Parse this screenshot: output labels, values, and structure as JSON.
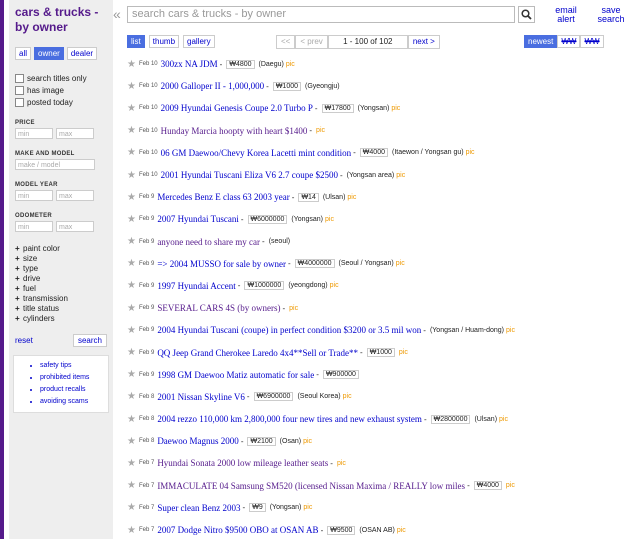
{
  "header": {
    "category_title": "cars & trucks - by owner",
    "search_placeholder": "search cars & trucks - by owner",
    "email_alert": "email alert",
    "save_search": "save search"
  },
  "sidebar": {
    "owner_tabs": [
      "all",
      "owner",
      "dealer"
    ],
    "selected_owner_tab": "owner",
    "checkboxes": [
      "search titles only",
      "has image",
      "posted today"
    ],
    "price_label": "PRICE",
    "min_placeholder": "min",
    "max_placeholder": "max",
    "make_model_label": "MAKE AND MODEL",
    "make_model_placeholder": "make / model",
    "model_year_label": "MODEL YEAR",
    "odometer_label": "ODOMETER",
    "expand_filters": [
      "paint color",
      "size",
      "type",
      "drive",
      "fuel",
      "transmission",
      "title status",
      "cylinders"
    ],
    "reset": "reset",
    "search": "search",
    "safety_links": [
      "safety tips",
      "prohibited items",
      "product recalls",
      "avoiding scams"
    ]
  },
  "view_tabs": [
    "list",
    "thumb",
    "gallery"
  ],
  "selected_view": "list",
  "pager": {
    "first": "<<",
    "prev": "< prev",
    "range": "1 - 100 of 102",
    "next": "next >"
  },
  "sort_tabs": [
    "newest",
    "₩₩",
    "₩₩"
  ],
  "listings": [
    {
      "date": "Feb 10",
      "title": "300zx NA JDM",
      "price": "₩4800",
      "location": "(Daegu)",
      "pic": "pic",
      "visited": false
    },
    {
      "date": "Feb 10",
      "title": "2000 Galloper II - 1,000,000",
      "price": "₩1000",
      "location": "(Gyeongju)",
      "pic": "",
      "visited": false
    },
    {
      "date": "Feb 10",
      "title": "2009 Hyundai Genesis Coupe 2.0 Turbo P",
      "price": "₩17800",
      "location": "(Yongsan)",
      "pic": "pic",
      "visited": false
    },
    {
      "date": "Feb 10",
      "title": "Hunday Marcia hoopty with heart $1400",
      "price": "",
      "location": "",
      "pic": "pic",
      "visited": true
    },
    {
      "date": "Feb 10",
      "title": "06 GM Daewoo/Chevy Korea Lacetti mint condition",
      "price": "₩4000",
      "location": "(Itaewon / Yongsan gu)",
      "pic": "pic",
      "visited": false
    },
    {
      "date": "Feb 10",
      "title": "2001 Hyundai Tuscani Eliza V6 2.7 coupe $2500",
      "price": "",
      "location": "(Yongsan area)",
      "pic": "pic",
      "visited": false
    },
    {
      "date": "Feb 9",
      "title": "Mercedes Benz E class 63 2003 year",
      "price": "₩14",
      "location": "(Ulsan)",
      "pic": "pic",
      "visited": false
    },
    {
      "date": "Feb 9",
      "title": "2007 Hyundai Tuscani",
      "price": "₩6000000",
      "location": "(Yongsan)",
      "pic": "pic",
      "visited": false
    },
    {
      "date": "Feb 9",
      "title": "anyone need to share my car",
      "price": "",
      "location": "(seoul)",
      "pic": "",
      "visited": true
    },
    {
      "date": "Feb 9",
      "title": "=> 2004 MUSSO for sale by owner",
      "price": "₩4000000",
      "location": "(Seoul / Yongsan)",
      "pic": "pic",
      "visited": false
    },
    {
      "date": "Feb 9",
      "title": "1997 Hyundai Accent",
      "price": "₩1000000",
      "location": "(yeongdong)",
      "pic": "pic",
      "visited": false
    },
    {
      "date": "Feb 9",
      "title": "SEVERAL CARS 4S (by owners)",
      "price": "",
      "location": "",
      "pic": "pic",
      "visited": true
    },
    {
      "date": "Feb 9",
      "title": "2004 Hyundai Tuscani (coupe) in perfect condition $3200 or 3.5 mil won",
      "price": "",
      "location": "(Yongsan / Huam-dong)",
      "pic": "pic",
      "visited": false
    },
    {
      "date": "Feb 9",
      "title": "QQ Jeep Grand Cherokee Laredo 4x4**Sell or Trade**",
      "price": "₩1000",
      "location": "",
      "pic": "pic",
      "visited": false
    },
    {
      "date": "Feb 9",
      "title": "1998 GM Daewoo Matiz automatic for sale",
      "price": "₩900000",
      "location": "",
      "pic": "",
      "visited": false
    },
    {
      "date": "Feb 8",
      "title": "2001 Nissan Skyline V6",
      "price": "₩6900000",
      "location": "(Seoul Korea)",
      "pic": "pic",
      "visited": false
    },
    {
      "date": "Feb 8",
      "title": "2004 rezzo 110,000 km 2,800,000 four new tires and new exhaust system",
      "price": "₩2800000",
      "location": "(Ulsan)",
      "pic": "pic",
      "visited": false
    },
    {
      "date": "Feb 8",
      "title": "Daewoo Magnus 2000",
      "price": "₩2100",
      "location": "(Osan)",
      "pic": "pic",
      "visited": false
    },
    {
      "date": "Feb 7",
      "title": "Hyundai Sonata 2000 low mileage leather seats",
      "price": "",
      "location": "",
      "pic": "pic",
      "visited": true
    },
    {
      "date": "Feb 7",
      "title": "IMMACULATE 04 Samsung SM520 (licensed Nissan Maxima / REALLY low miles",
      "price": "₩4000",
      "location": "",
      "pic": "pic",
      "visited": true
    },
    {
      "date": "Feb 7",
      "title": "Super clean Benz 2003",
      "price": "₩9",
      "location": "(Yongsan)",
      "pic": "pic",
      "visited": false
    },
    {
      "date": "Feb 7",
      "title": "2007 Dodge Nitro $9500 OBO at OSAN AB",
      "price": "₩9500",
      "location": "(OSAN AB)",
      "pic": "pic",
      "visited": false
    }
  ]
}
